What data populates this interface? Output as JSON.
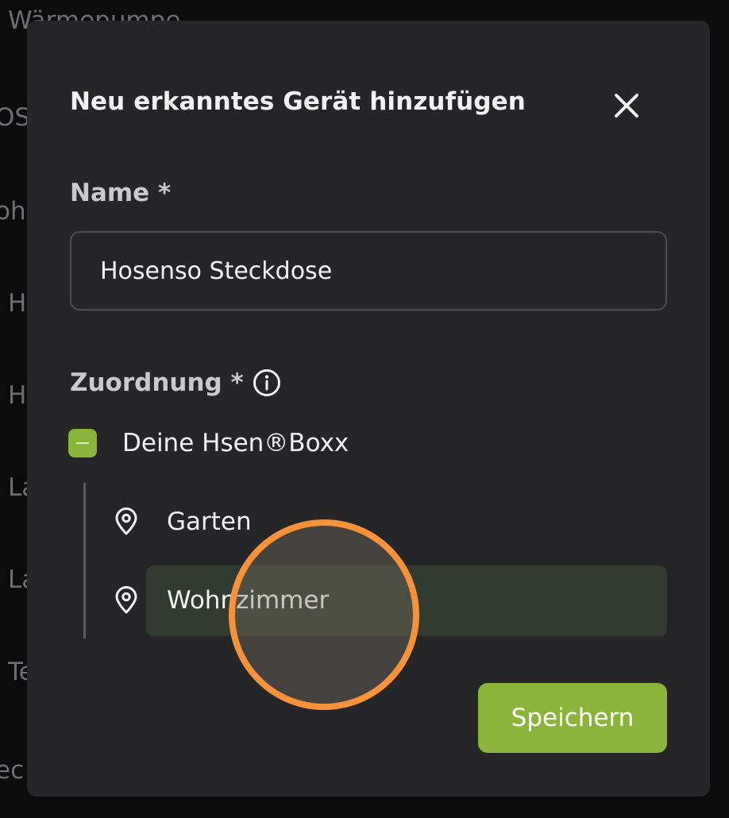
{
  "background": {
    "items": [
      "Wärmepumpe",
      "OS",
      "ohr",
      "H",
      "H",
      "La",
      "La",
      "Te",
      "ec"
    ]
  },
  "modal": {
    "title": "Neu erkanntes Gerät hinzufügen",
    "close_icon": "close-icon"
  },
  "name_field": {
    "label": "Name *",
    "value": "Hosenso Steckdose"
  },
  "assignment": {
    "label": "Zuordnung *",
    "info_icon": "info-icon",
    "root": {
      "label": "Deine Hsen®Boxx",
      "state": "indeterminate"
    },
    "items": [
      {
        "label": "Garten",
        "icon": "location-pin-icon",
        "selected": false
      },
      {
        "label": "Wohnzimmer",
        "icon": "location-pin-icon",
        "selected": true
      }
    ]
  },
  "actions": {
    "save_label": "Speichern"
  },
  "colors": {
    "accent": "#8bb43a",
    "touch_indicator": "#f5923a",
    "modal_bg": "#262628"
  }
}
